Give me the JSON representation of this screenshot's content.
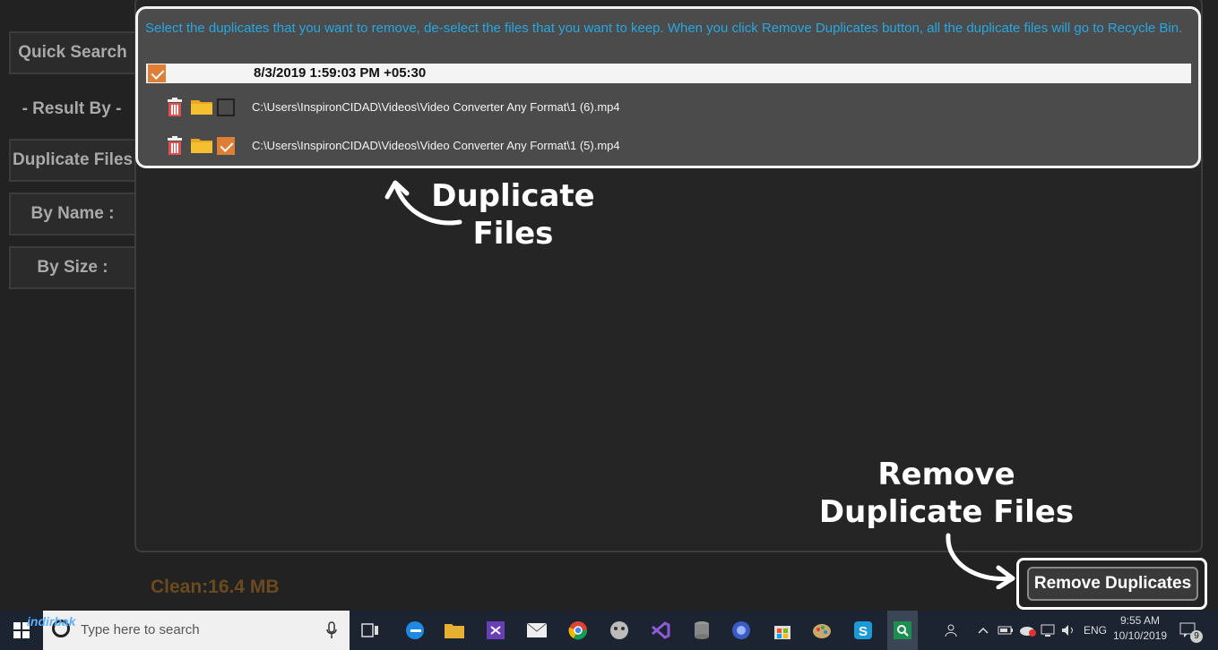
{
  "sidebar": {
    "quick_search": "Quick Search",
    "result_by": "- Result By -",
    "duplicate_files": "Duplicate Files:",
    "by_name": "By Name :",
    "by_size": "By Size :"
  },
  "duplicates": {
    "instructions": "Select the duplicates that you want to remove, de-select the files that you want to keep. When you click Remove Duplicates button, all the duplicate files will go to Recycle Bin.",
    "group_date": "8/3/2019 1:59:03 PM +05:30",
    "group_checked": true,
    "files": [
      {
        "path": "C:\\Users\\InspironCIDAD\\Videos\\Video Converter Any Format\\1 (6).mp4",
        "checked": false
      },
      {
        "path": "C:\\Users\\InspironCIDAD\\Videos\\Video Converter Any Format\\1 (5).mp4",
        "checked": true
      }
    ]
  },
  "annotations": {
    "duplicate_files_line1": "Duplicate",
    "duplicate_files_line2": "Files",
    "remove_line1": "Remove",
    "remove_line2": "Duplicate Files"
  },
  "footer": {
    "clean": "Clean:16.4 MB",
    "remove_button": "Remove Duplicates"
  },
  "taskbar": {
    "search_placeholder": "Type here to search",
    "watermark": "indirbak",
    "language": "ENG",
    "time": "9:55 AM",
    "date": "10/10/2019",
    "notification_count": "9"
  },
  "colors": {
    "accent_orange": "#de7f37",
    "instruction_blue": "#27a7e2",
    "clean_text": "#6b4a1f"
  }
}
